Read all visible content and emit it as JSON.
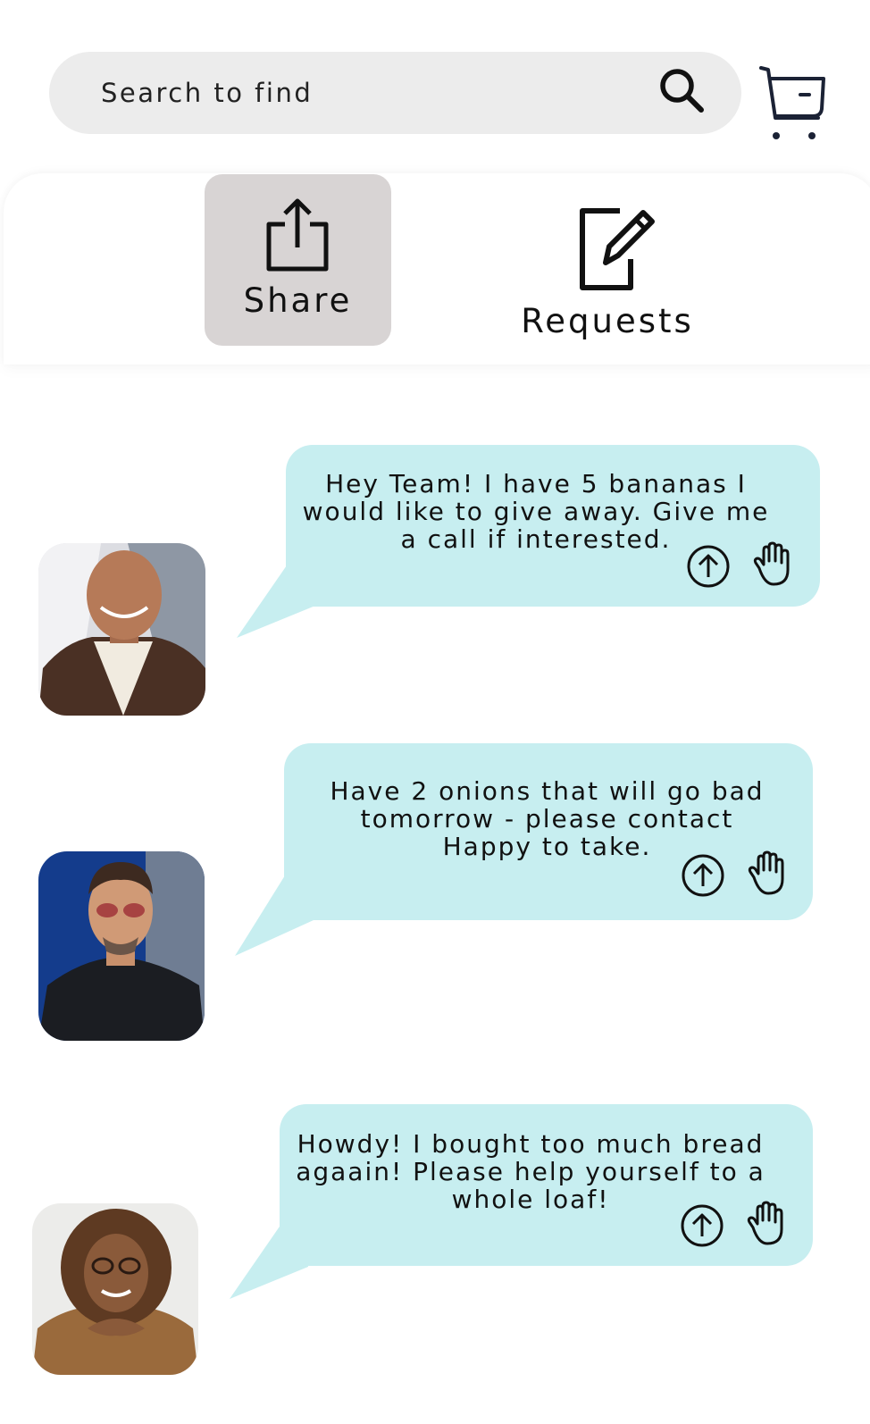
{
  "search": {
    "placeholder": "Search to find"
  },
  "tabs": {
    "share_label": "Share",
    "requests_label": "Requests"
  },
  "posts": [
    {
      "text": "Hey Team! I have 5 bananas I would like to give away. Give me a call if interested."
    },
    {
      "text": "Have 2 onions that will go bad tomorrow - please contact Happy to take."
    },
    {
      "text": "Howdy! I bought too much bread agaain! Please help yourself to a whole loaf!"
    }
  ],
  "colors": {
    "bubble": "#c7eef0",
    "search_bg": "#ececec",
    "active_tab": "#d8d4d4",
    "cart": "#1b2235"
  },
  "icons": [
    "search-icon",
    "cart-icon",
    "share-icon",
    "edit-icon",
    "upvote-icon",
    "raise-hand-icon"
  ]
}
